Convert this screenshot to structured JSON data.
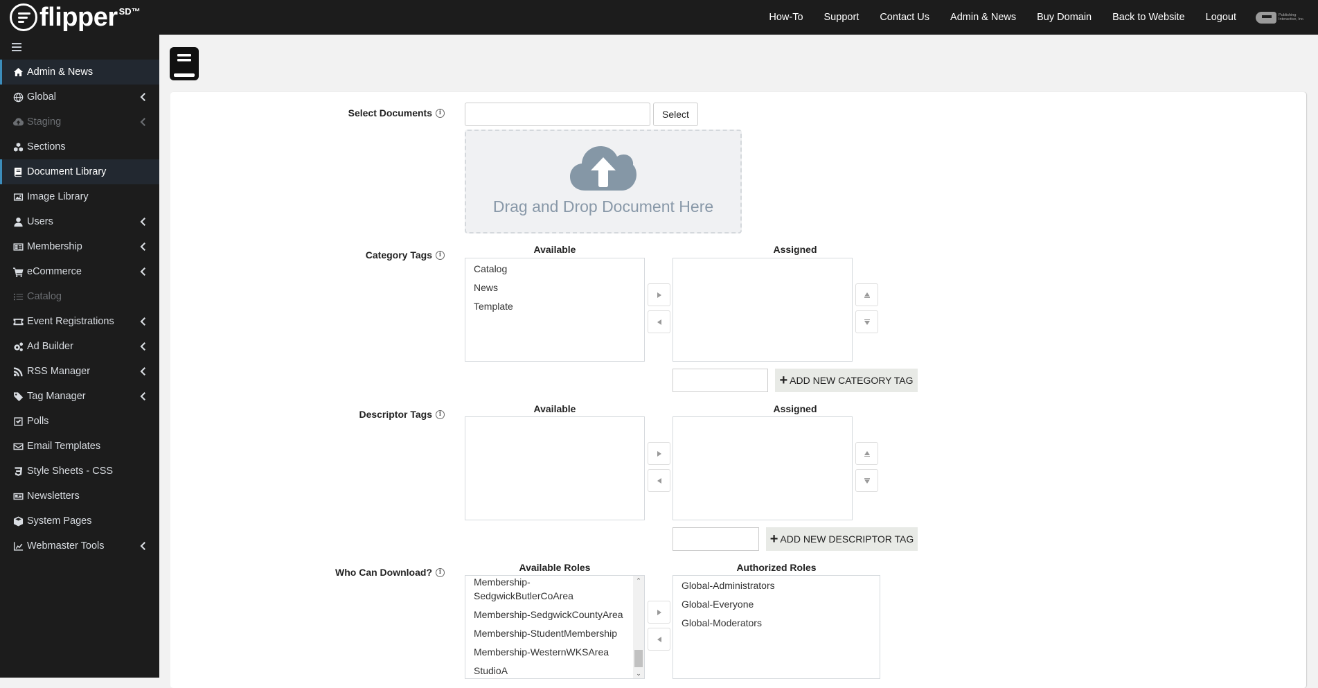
{
  "brand": {
    "name": "flipper",
    "superscript": "SD™"
  },
  "topnav": [
    {
      "label": "How-To"
    },
    {
      "label": "Support"
    },
    {
      "label": "Contact Us"
    },
    {
      "label": "Admin & News"
    },
    {
      "label": "Buy Domain"
    },
    {
      "label": "Back to Website"
    },
    {
      "label": "Logout"
    }
  ],
  "publisher": {
    "line1": "Publishing",
    "line2": "Interactive, Inc."
  },
  "sidebar": {
    "items": [
      {
        "label": "Admin & News",
        "icon": "home-icon",
        "state": "active",
        "submenu": false
      },
      {
        "label": "Global",
        "icon": "globe-icon",
        "state": "normal",
        "submenu": true
      },
      {
        "label": "Staging",
        "icon": "cloud-upload-icon",
        "state": "disabled",
        "submenu": true
      },
      {
        "label": "Sections",
        "icon": "cubes-icon",
        "state": "normal",
        "submenu": false
      },
      {
        "label": "Document Library",
        "icon": "book-icon",
        "state": "active",
        "submenu": false
      },
      {
        "label": "Image Library",
        "icon": "image-icon",
        "state": "normal",
        "submenu": false
      },
      {
        "label": "Users",
        "icon": "user-icon",
        "state": "normal",
        "submenu": true
      },
      {
        "label": "Membership",
        "icon": "id-card-icon",
        "state": "normal",
        "submenu": true
      },
      {
        "label": "eCommerce",
        "icon": "cart-icon",
        "state": "normal",
        "submenu": true
      },
      {
        "label": "Catalog",
        "icon": "list-icon",
        "state": "disabled",
        "submenu": false
      },
      {
        "label": "Event Registrations",
        "icon": "ticket-icon",
        "state": "normal",
        "submenu": true
      },
      {
        "label": "Ad Builder",
        "icon": "cogs-icon",
        "state": "normal",
        "submenu": true
      },
      {
        "label": "RSS Manager",
        "icon": "rss-icon",
        "state": "normal",
        "submenu": true
      },
      {
        "label": "Tag Manager",
        "icon": "tag-icon",
        "state": "normal",
        "submenu": true
      },
      {
        "label": "Polls",
        "icon": "checkbox-icon",
        "state": "normal",
        "submenu": false
      },
      {
        "label": "Email Templates",
        "icon": "envelope-icon",
        "state": "normal",
        "submenu": false
      },
      {
        "label": "Style Sheets - CSS",
        "icon": "css3-icon",
        "state": "normal",
        "submenu": false
      },
      {
        "label": "Newsletters",
        "icon": "newspaper-icon",
        "state": "normal",
        "submenu": false
      },
      {
        "label": "System Pages",
        "icon": "box-icon",
        "state": "normal",
        "submenu": false
      },
      {
        "label": "Webmaster Tools",
        "icon": "chart-line-icon",
        "state": "normal",
        "submenu": true
      }
    ]
  },
  "form": {
    "select_documents": {
      "label": "Select Documents",
      "input_value": "",
      "button_label": "Select",
      "dropzone_text": "Drag and Drop Document Here"
    },
    "category_tags": {
      "label": "Category Tags",
      "available_header": "Available",
      "assigned_header": "Assigned",
      "available": [
        "Catalog",
        "News",
        "Template"
      ],
      "assigned": [],
      "new_tag_value": "",
      "add_button_label": "ADD NEW CATEGORY TAG"
    },
    "descriptor_tags": {
      "label": "Descriptor Tags",
      "available_header": "Available",
      "assigned_header": "Assigned",
      "available": [],
      "assigned": [],
      "new_tag_value": "",
      "add_button_label": "ADD NEW DESCRIPTOR TAG"
    },
    "who_can_download": {
      "label": "Who Can Download?",
      "available_header": "Available Roles",
      "authorized_header": "Authorized Roles",
      "available": [
        "Membership-SedgwickButlerCoArea",
        "Membership-SedgwickCountyArea",
        "Membership-StudentMembership",
        "Membership-WesternWKSArea",
        "StudioA"
      ],
      "authorized": [
        "Global-Administrators",
        "Global-Everyone",
        "Global-Moderators"
      ]
    }
  },
  "colors": {
    "sidebar_bg": "#1c1c1c",
    "active_accent": "#3c8dbc",
    "dropzone_icon": "#8597a6"
  }
}
